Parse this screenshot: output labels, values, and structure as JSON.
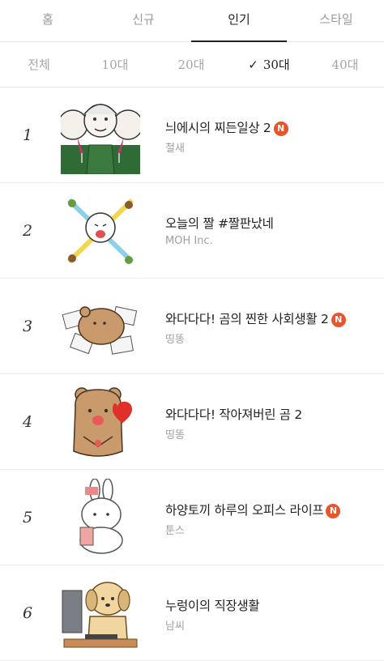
{
  "tabs": [
    {
      "label": "홈",
      "active": false
    },
    {
      "label": "신규",
      "active": false
    },
    {
      "label": "인기",
      "active": true
    },
    {
      "label": "스타일",
      "active": false
    }
  ],
  "filters": [
    {
      "label": "전체",
      "active": false
    },
    {
      "label": "10대",
      "active": false
    },
    {
      "label": "20대",
      "active": false
    },
    {
      "label": "30대",
      "active": true
    },
    {
      "label": "40대",
      "active": false
    }
  ],
  "check_glyph": "✓",
  "items": [
    {
      "rank": "1",
      "title": "늬에시의 찌든일상 2",
      "author": "철새",
      "new": true,
      "thumb": "three-men-toasting-icon"
    },
    {
      "rank": "2",
      "title": "오늘의 짤 #짤판났네",
      "author": "MOH Inc.",
      "new": false,
      "thumb": "screaming-character-icon"
    },
    {
      "rank": "3",
      "title": "와다다다! 곰의 찐한 사회생활 2",
      "author": "띵똥",
      "new": true,
      "thumb": "bear-with-papers-icon"
    },
    {
      "rank": "4",
      "title": "와다다다! 작아져버린 곰 2",
      "author": "띵똥",
      "new": false,
      "thumb": "bear-holding-heart-icon"
    },
    {
      "rank": "5",
      "title": "하양토끼 하루의 오피스 라이프",
      "author": "툰스",
      "new": true,
      "thumb": "white-rabbit-icon"
    },
    {
      "rank": "6",
      "title": "누렁이의 직장생활",
      "author": "남씨",
      "new": false,
      "thumb": "dog-at-computer-icon"
    }
  ],
  "badge_label": "N",
  "colors": {
    "accent": "#e8542b",
    "active_text": "#222222",
    "inactive_text": "#a5a5a5",
    "divider": "#e6e6e6"
  }
}
